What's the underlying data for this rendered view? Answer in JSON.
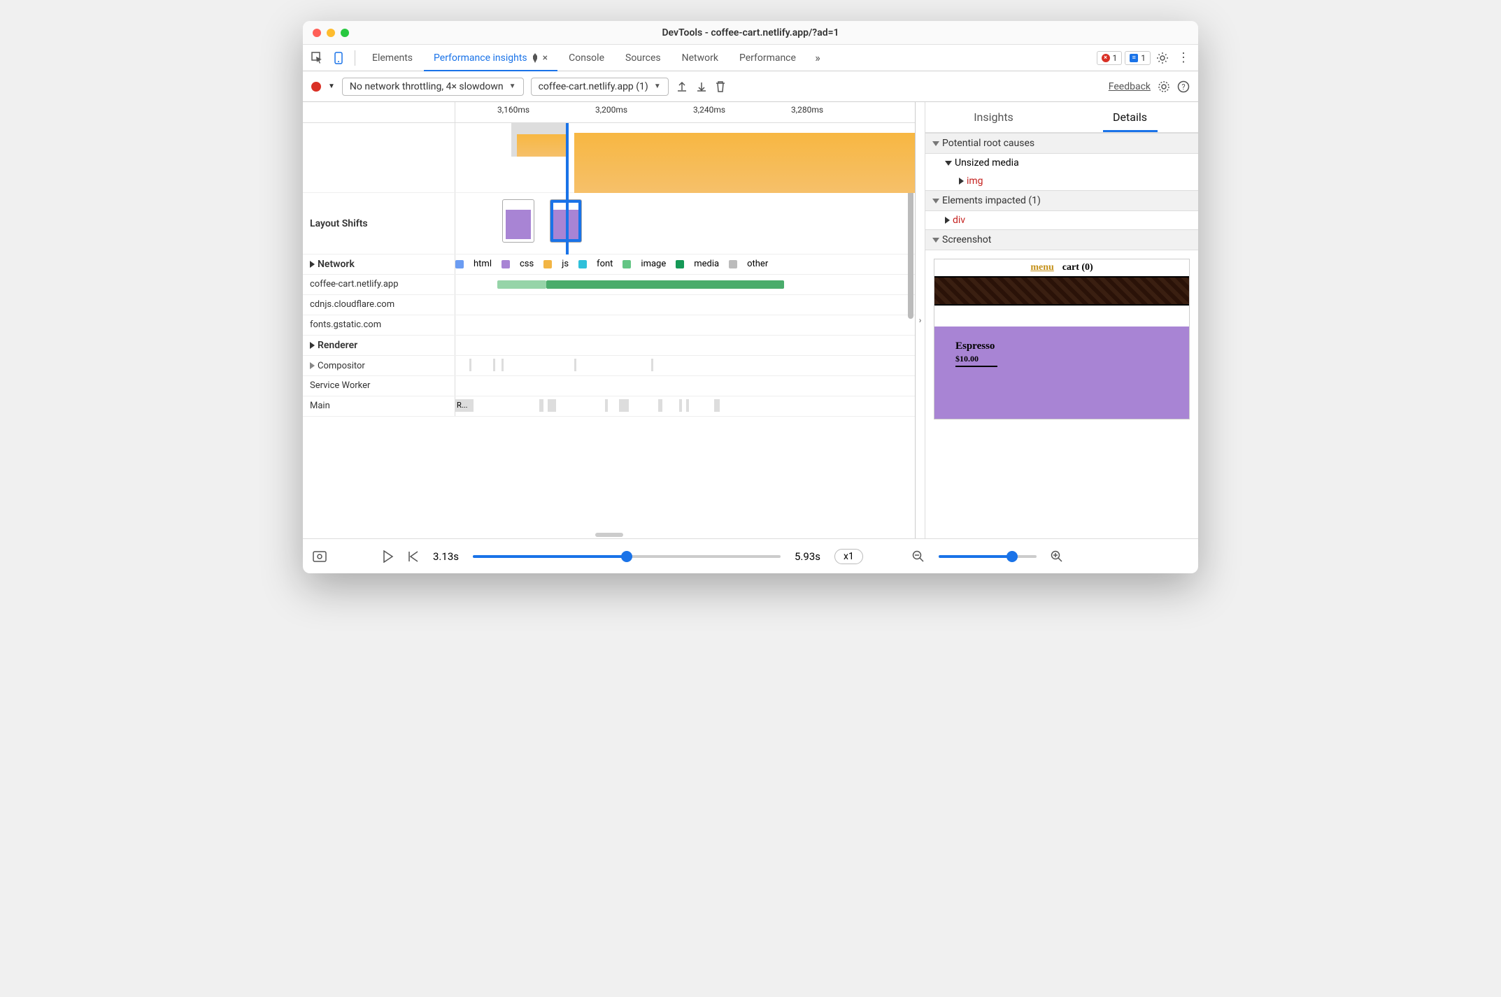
{
  "window": {
    "title": "DevTools - coffee-cart.netlify.app/?ad=1"
  },
  "tabs": {
    "elements": "Elements",
    "performance_insights": "Performance insights",
    "console": "Console",
    "sources": "Sources",
    "network": "Network",
    "performance": "Performance"
  },
  "badges": {
    "error_count": "1",
    "info_count": "1"
  },
  "toolbar": {
    "throttling": "No network throttling, 4× slowdown",
    "recording": "coffee-cart.netlify.app (1)",
    "feedback": "Feedback"
  },
  "ruler": {
    "t1": "3,160ms",
    "t2": "3,200ms",
    "t3": "3,240ms",
    "t4": "3,280ms"
  },
  "timeline": {
    "layout_shifts": "Layout Shifts",
    "network": "Network",
    "hosts": {
      "h1": "coffee-cart.netlify.app",
      "h2": "cdnjs.cloudflare.com",
      "h3": "fonts.gstatic.com"
    },
    "renderer": "Renderer",
    "compositor": "Compositor",
    "service_worker": "Service Worker",
    "main": "Main",
    "main_task": "R..."
  },
  "legend": {
    "html": "html",
    "css": "css",
    "js": "js",
    "font": "font",
    "image": "image",
    "media": "media",
    "other": "other"
  },
  "details": {
    "tab_insights": "Insights",
    "tab_details": "Details",
    "root_causes": "Potential root causes",
    "unsized_media": "Unsized media",
    "img": "img",
    "elements_impacted": "Elements impacted (1)",
    "div": "div",
    "screenshot": "Screenshot",
    "shot_menu": "menu",
    "shot_cart": "cart (0)",
    "shot_product": "Espresso",
    "shot_price": "$10.00"
  },
  "footer": {
    "start": "3.13s",
    "end": "5.93s",
    "speed": "x1"
  }
}
